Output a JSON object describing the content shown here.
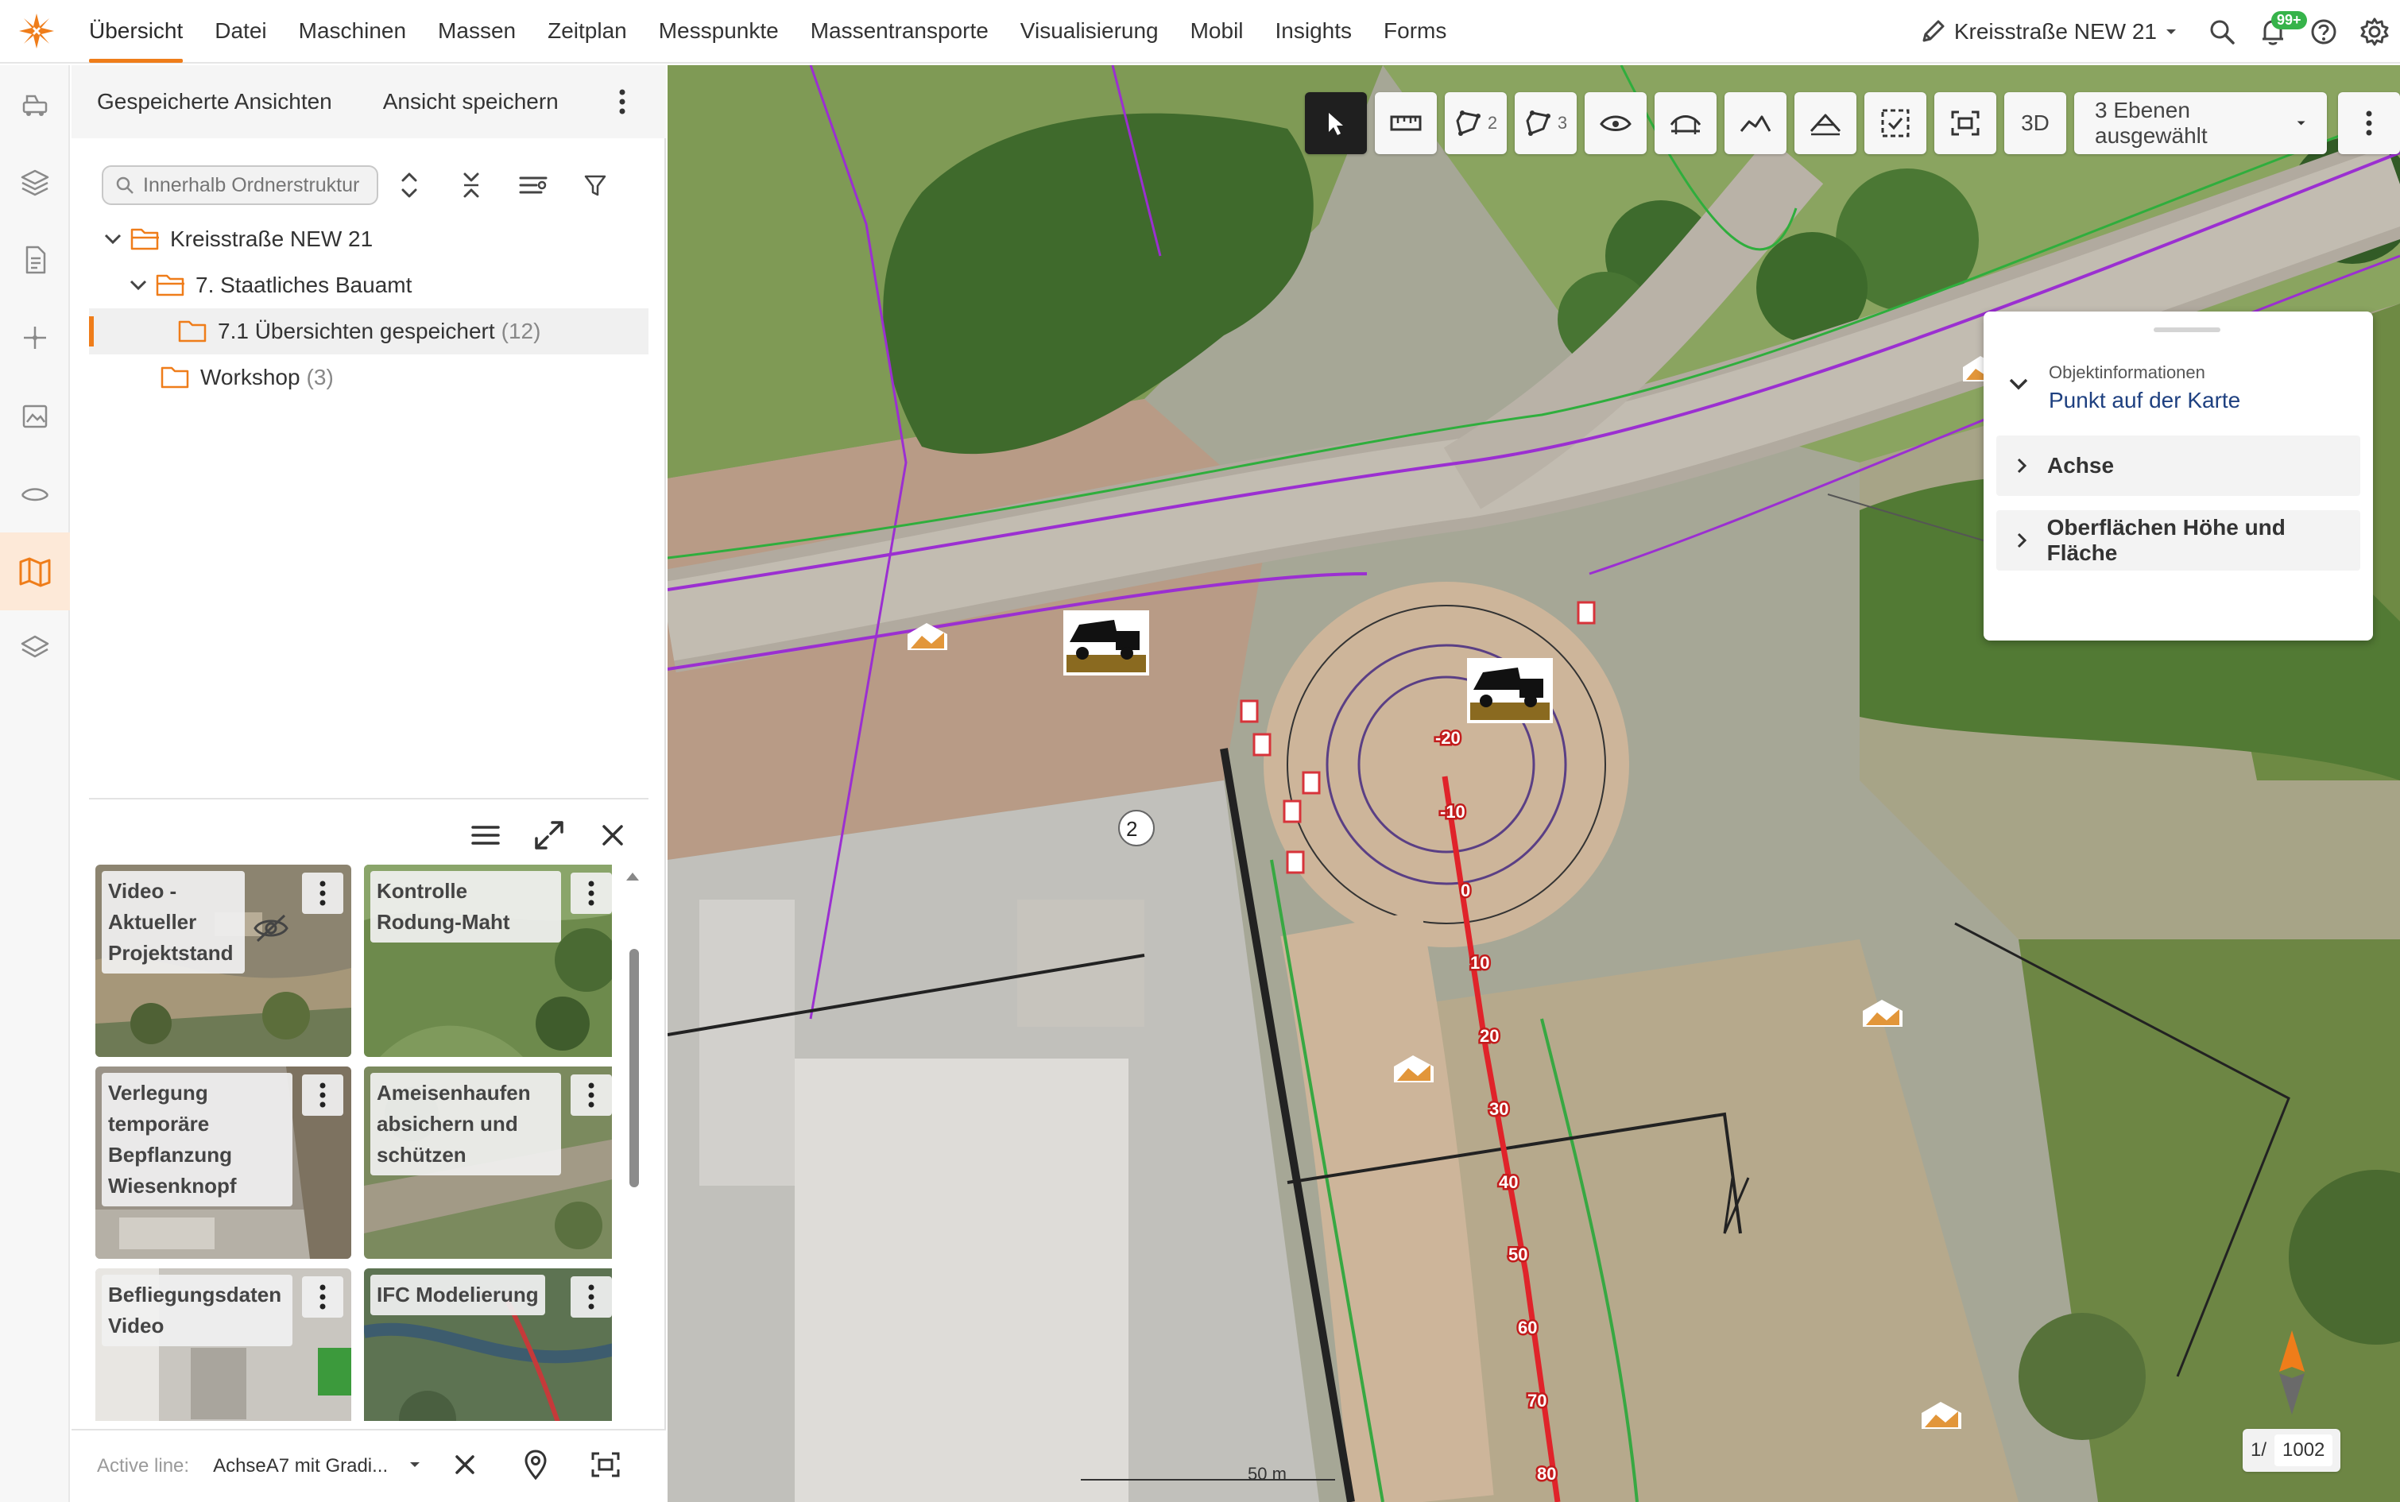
{
  "nav": {
    "items": [
      "Übersicht",
      "Datei",
      "Maschinen",
      "Massen",
      "Zeitplan",
      "Messpunkte",
      "Massentransporte",
      "Visualisierung",
      "Mobil",
      "Insights",
      "Forms"
    ],
    "active_index": 0
  },
  "header": {
    "project_name": "Kreisstraße NEW 21",
    "notification_badge": "99+"
  },
  "panel": {
    "tab_saved_views": "Gespeicherte Ansichten",
    "tab_save_view": "Ansicht speichern",
    "search_placeholder": "Innerhalb Ordnerstruktur",
    "tree": [
      {
        "label": "Kreisstraße NEW 21",
        "count": ""
      },
      {
        "label": "7. Staatliches Bauamt",
        "count": ""
      },
      {
        "label": "7.1 Übersichten gespeichert",
        "count": "(12)"
      },
      {
        "label": "Workshop",
        "count": "(3)"
      }
    ]
  },
  "gallery": {
    "cards": [
      {
        "title": "Video - Aktueller Projektstand"
      },
      {
        "title": "Kontrolle Rodung-Maht"
      },
      {
        "title": "Verlegung temporäre Bepflanzung Wiesenknopf"
      },
      {
        "title": "Ameisenhaufen absichern und schützen"
      },
      {
        "title": "Befliegungsdaten Video"
      },
      {
        "title": "IFC Modelierung"
      }
    ]
  },
  "active_line": {
    "label": "Active line:",
    "value": "AchseA7 mit Gradi..."
  },
  "map": {
    "toolbar": {
      "polygon2_count": "2",
      "polygon3_count": "3",
      "mode_3d": "3D",
      "layers_label": "3 Ebenen ausgewählt"
    },
    "info": {
      "subtitle": "Objektinformationen",
      "title": "Punkt auf der Karte",
      "sections": [
        "Achse",
        "Oberflächen Höhe und Fläche"
      ]
    },
    "pager": {
      "current": "1/",
      "total": "1002"
    },
    "scale": "50 m",
    "stations": [
      "-20",
      "-10",
      "0",
      "10",
      "20",
      "30",
      "40",
      "50",
      "60",
      "70",
      "80"
    ],
    "cluster_count": "2"
  },
  "colors": {
    "accent": "#ef7d1a",
    "axis_red": "#e0232a",
    "plan_purple": "#9b2fd1"
  }
}
